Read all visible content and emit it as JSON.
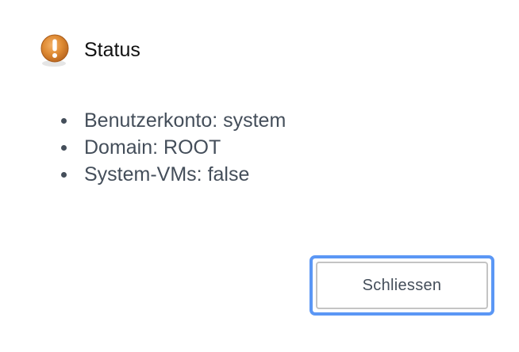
{
  "dialog": {
    "title": "Status",
    "icon": "exclamation-warning-icon",
    "accent_color": "#d9802a",
    "items": [
      "Benutzerkonto: system",
      "Domain: ROOT",
      "System-VMs: false"
    ],
    "close_label": "Schliessen",
    "focus_color": "#5b97f5"
  }
}
